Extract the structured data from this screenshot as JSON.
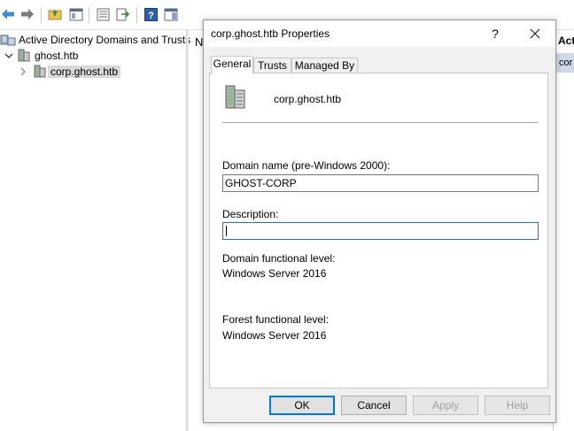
{
  "toolbar": {
    "buttons": [
      "back-icon",
      "forward-icon",
      "folder-up-icon",
      "console-tree-icon",
      "properties-icon",
      "export-list-icon",
      "help-icon",
      "action-pane-icon"
    ]
  },
  "tree": {
    "root_label": "Active Directory Domains and Trusts",
    "domain_label": "ghost.htb",
    "child_label": "corp.ghost.htb"
  },
  "middle_header_fragment": "N",
  "right_pane": {
    "header": "Acti",
    "cell": "cor"
  },
  "dialog": {
    "title": "corp.ghost.htb Properties",
    "help_glyph": "?",
    "tabs": [
      {
        "label": "General",
        "active": true
      },
      {
        "label": "Trusts",
        "active": false
      },
      {
        "label": "Managed By",
        "active": false
      }
    ],
    "domain_display_name": "corp.ghost.htb",
    "prewin_label": "Domain name (pre-Windows 2000):",
    "prewin_value": "GHOST-CORP",
    "description_label": "Description:",
    "description_value": "",
    "domain_level_label": "Domain functional level:",
    "domain_level_value": "Windows Server 2016",
    "forest_level_label": "Forest functional level:",
    "forest_level_value": "Windows Server 2016",
    "buttons": {
      "ok": "OK",
      "cancel": "Cancel",
      "apply": "Apply",
      "help": "Help"
    }
  },
  "colors": {
    "accent": "#0078d7",
    "focus_border": "#2a7a8f",
    "selection": "#d9d9d9"
  }
}
